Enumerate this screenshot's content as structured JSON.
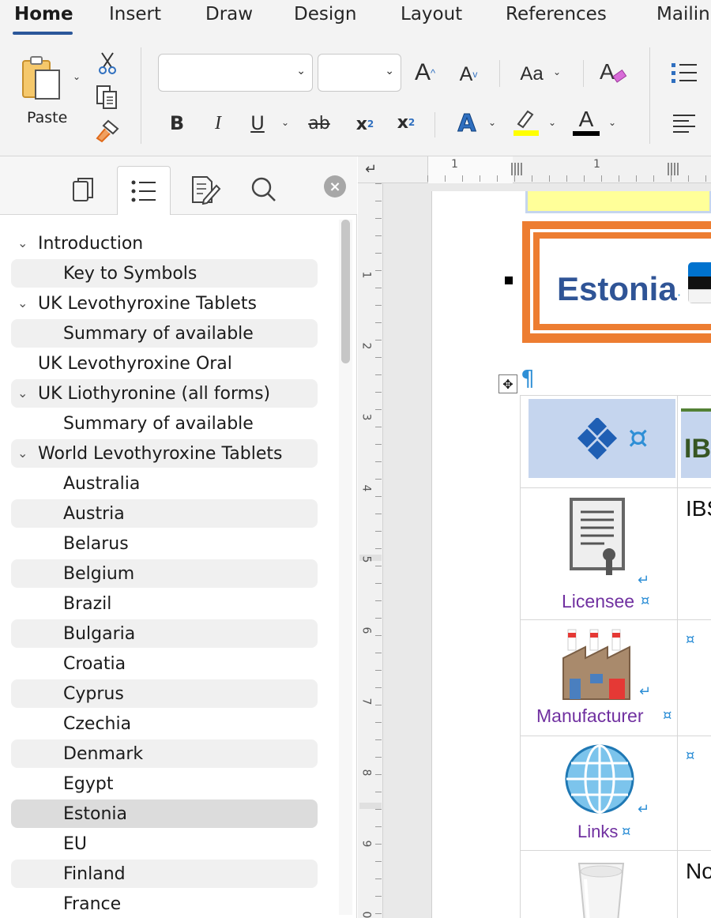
{
  "tabs": [
    "Home",
    "Insert",
    "Draw",
    "Design",
    "Layout",
    "References",
    "Mailin"
  ],
  "ribbon": {
    "paste_label": "Paste",
    "font_name": "",
    "font_size": "",
    "grow_font": "A",
    "shrink_font": "A",
    "change_case": "Aa",
    "bold": "B",
    "italic": "I",
    "underline": "U",
    "strikethrough": "ab",
    "subscript": "x",
    "subscript_mark": "2",
    "superscript": "x",
    "superscript_mark": "2",
    "text_effects": "A",
    "font_color": "A",
    "highlight_color": "#ffff00",
    "font_color_value": "#000000"
  },
  "sidebar": {
    "items": [
      {
        "label": "Introduction",
        "level": 1,
        "expanded": true
      },
      {
        "label": "Key to Symbols",
        "level": 2
      },
      {
        "label": "UK Levothyroxine Tablets",
        "level": 1,
        "expanded": true
      },
      {
        "label": "Summary of available",
        "level": 2
      },
      {
        "label": "UK Levothyroxine Oral",
        "level": 1
      },
      {
        "label": "UK Liothyronine (all forms)",
        "level": 1,
        "expanded": true
      },
      {
        "label": "Summary of available",
        "level": 2
      },
      {
        "label": "World Levothyroxine Tablets",
        "level": 1,
        "expanded": true
      },
      {
        "label": "Australia",
        "level": 2
      },
      {
        "label": "Austria",
        "level": 2
      },
      {
        "label": "Belarus",
        "level": 2
      },
      {
        "label": "Belgium",
        "level": 2
      },
      {
        "label": "Brazil",
        "level": 2
      },
      {
        "label": "Bulgaria",
        "level": 2
      },
      {
        "label": "Croatia",
        "level": 2
      },
      {
        "label": "Cyprus",
        "level": 2
      },
      {
        "label": "Czechia",
        "level": 2
      },
      {
        "label": "Denmark",
        "level": 2
      },
      {
        "label": "Egypt",
        "level": 2
      },
      {
        "label": "Estonia",
        "level": 2,
        "selected": true
      },
      {
        "label": "EU",
        "level": 2
      },
      {
        "label": "Finland",
        "level": 2
      },
      {
        "label": "France",
        "level": 2
      }
    ]
  },
  "ruler": {
    "h_numbers": [
      "1",
      "1"
    ],
    "v_numbers": [
      "1",
      "2",
      "3",
      "4",
      "5",
      "6",
      "7",
      "8",
      "9",
      "0"
    ]
  },
  "document": {
    "heading": "Estonia",
    "pilcrow": "¶",
    "header_cell_text": "IB",
    "rows": [
      {
        "label": "Licensee",
        "value": "IBS"
      },
      {
        "label": "Manufacturer",
        "value": ""
      },
      {
        "label": "Links",
        "value": ""
      },
      {
        "label": "",
        "value": "No"
      }
    ],
    "cell_marker": "¤",
    "line_break": "↵"
  },
  "colors": {
    "accent": "#2b579a",
    "heading_border": "#ed7d31",
    "heading_text": "#2f5496",
    "label_text": "#7030a0",
    "header_fill": "#c5d5ee",
    "highlight_band": "#ffff99"
  }
}
